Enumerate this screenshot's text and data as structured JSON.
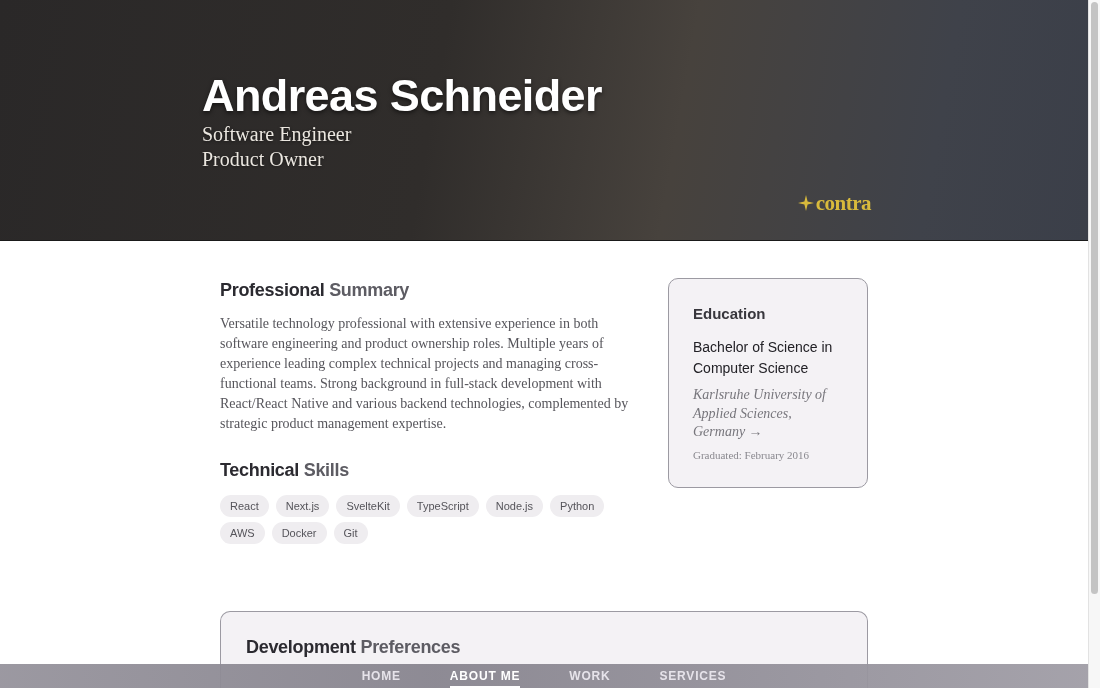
{
  "hero": {
    "name": "Andreas Schneider",
    "roles": [
      "Software Engineer",
      "Product Owner"
    ],
    "logo": "contra"
  },
  "summary": {
    "heading": {
      "lead": "Professional",
      "rest": "Summary"
    },
    "text": "Versatile technology professional with extensive experience in both software engineering and product ownership roles. Multiple years of experience leading complex technical projects and managing cross-functional teams. Strong background in full-stack development with React/React Native and various backend technologies, complemented by strategic product management expertise."
  },
  "skills": {
    "heading": {
      "lead": "Technical",
      "rest": "Skills"
    },
    "items": [
      "React",
      "Next.js",
      "SvelteKit",
      "TypeScript",
      "Node.js",
      "Python",
      "AWS",
      "Docker",
      "Git"
    ]
  },
  "education": {
    "heading": "Education",
    "degree": "Bachelor of Science in Computer Science",
    "school": "Karlsruhe University of Applied Sciences, Germany →",
    "graduated": "Graduated: February 2016"
  },
  "preferences": {
    "heading": {
      "lead": "Development",
      "rest": "Preferences"
    }
  },
  "nav": [
    {
      "label": "HOME",
      "selected": false
    },
    {
      "label": "ABOUT ME",
      "selected": true
    },
    {
      "label": "WORK",
      "selected": false
    },
    {
      "label": "SERVICES",
      "selected": false
    }
  ]
}
